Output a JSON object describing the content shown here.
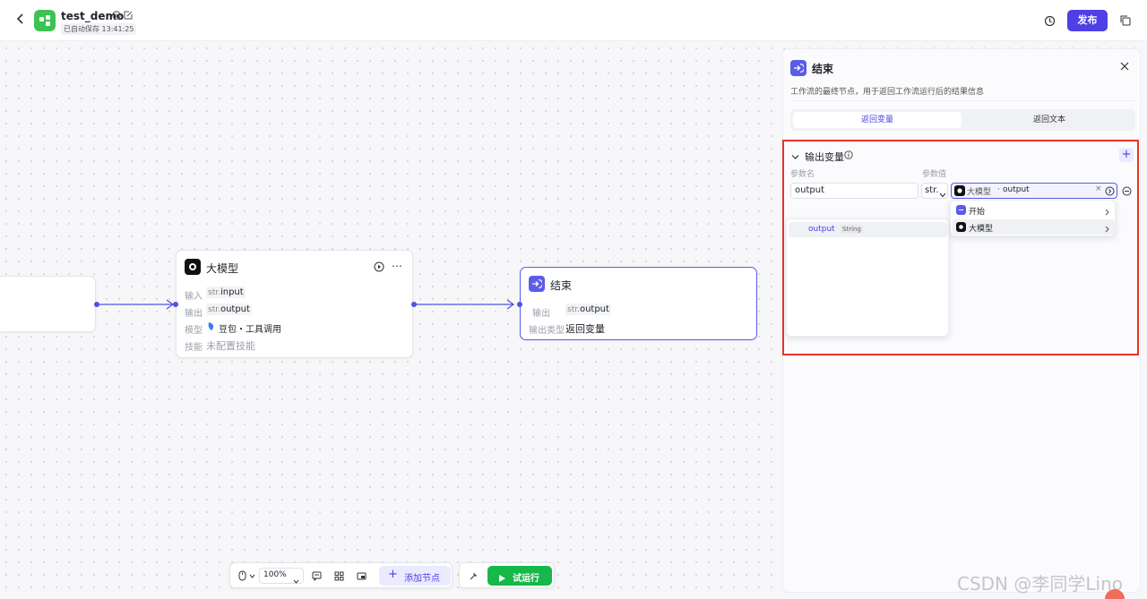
{
  "header": {
    "back_icon": "chevron-left-icon",
    "app_title": "test_demo",
    "save_status": "已自动保存 13:41:25",
    "publish_label": "发布"
  },
  "canvas": {
    "llm_node": {
      "title": "大模型",
      "input_label": "输入",
      "input_type": "str.",
      "input_value": "input",
      "output_label": "输出",
      "output_type": "str.",
      "output_value": "output",
      "model_label": "模型",
      "model_value": "豆包・工具调用",
      "skill_label": "技能",
      "skill_value": "未配置技能"
    },
    "end_node": {
      "title": "结束",
      "output_label": "输出",
      "output_type": "str.",
      "output_value": "output",
      "output_type_label": "输出类型",
      "output_type_value": "返回变量"
    }
  },
  "panel": {
    "title": "结束",
    "description": "工作流的最终节点，用于返回工作流运行后的结果信息",
    "tabs": [
      "返回变量",
      "返回文本"
    ],
    "active_tab": 0,
    "section_title": "输出变量",
    "col_name": "参数名",
    "col_value": "参数值",
    "param_name": "output",
    "param_type": "str.",
    "ref_node": "大模型",
    "ref_var": "output",
    "menu_items": [
      "开始",
      "大模型"
    ],
    "submenu_var": "output",
    "submenu_type": "String"
  },
  "toolbar": {
    "zoom": "100%",
    "add_node_label": "添加节点",
    "run_label": "试运行"
  },
  "watermark": "CSDN @李同学Lino",
  "colors": {
    "accent": "#4e40e5",
    "run_green": "#17b84a",
    "logo_green": "#3ec254",
    "highlight_red": "#e5332a"
  }
}
